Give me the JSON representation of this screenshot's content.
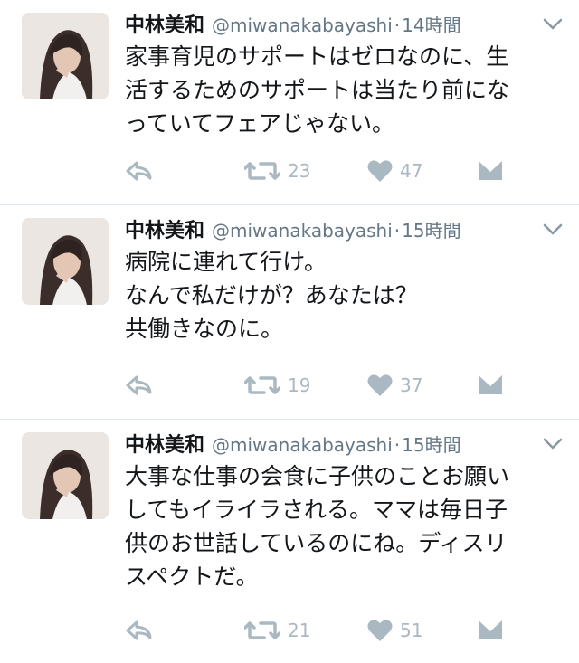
{
  "tweets": [
    {
      "name": "中林美和",
      "handle": "@miwanakabayashi",
      "separator": "·",
      "time": "14時間",
      "lines": [
        "家事育児のサポートはゼロなのに、生",
        "活するためのサポートは当たり前にな",
        "っていてフェアじゃない。"
      ],
      "retweets": "23",
      "likes": "47"
    },
    {
      "name": "中林美和",
      "handle": "@miwanakabayashi",
      "separator": "·",
      "time": "15時間",
      "lines": [
        "病院に連れて行け。",
        "なんで私だけが？あなたは？",
        "共働きなのに。"
      ],
      "retweets": "19",
      "likes": "37"
    },
    {
      "name": "中林美和",
      "handle": "@miwanakabayashi",
      "separator": "·",
      "time": "15時間",
      "lines": [
        "大事な仕事の会食に子供のことお願い",
        "してもイライラされる。ママは毎日子",
        "供のお世話しているのにね。ディスリ",
        "スペクトだ。"
      ],
      "retweets": "21",
      "likes": "51"
    }
  ],
  "icons": {
    "reply": "reply-icon",
    "retweet": "retweet-icon",
    "like": "heart-icon",
    "dm": "envelope-icon",
    "caret": "chevron-down-icon"
  },
  "colors": {
    "text": "#14171a",
    "secondary": "#657786",
    "action": "#aab8c2",
    "divider": "#e1e8ed"
  }
}
